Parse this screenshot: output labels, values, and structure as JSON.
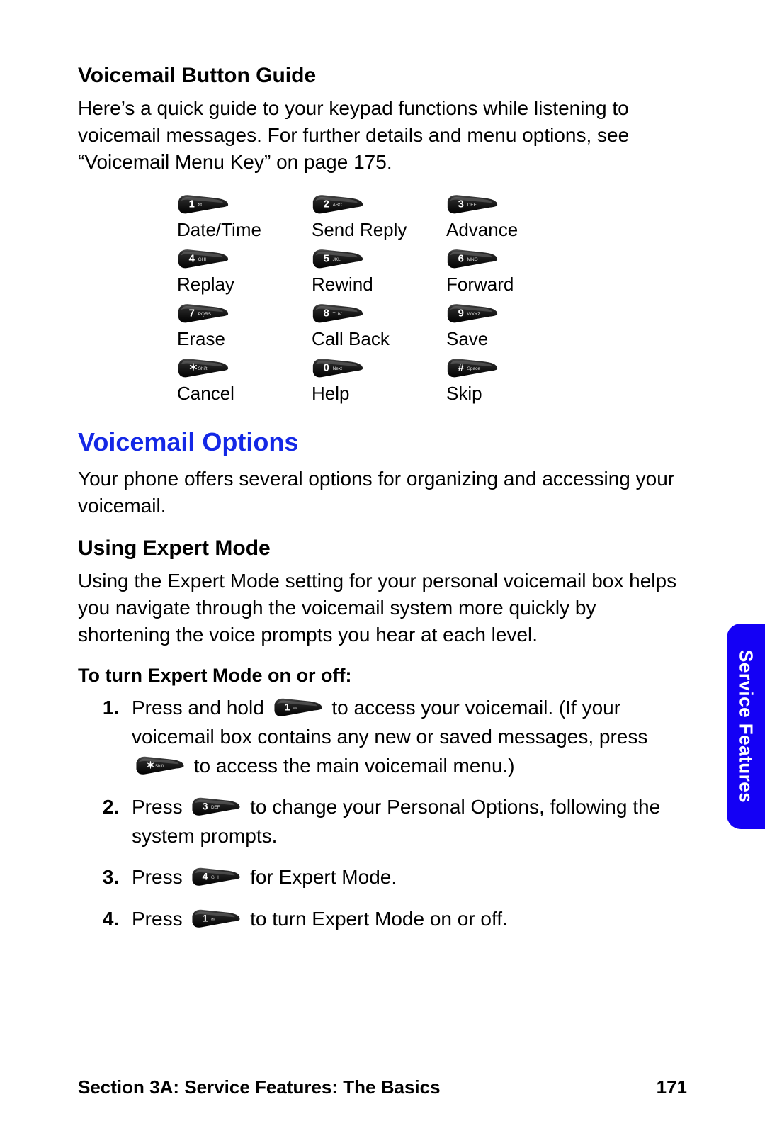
{
  "h1": "Voicemail Button Guide",
  "intro": "Here’s a quick guide to your keypad functions while listening to voicemail messages. For further details and menu options, see “Voicemail Menu Key” on page 175.",
  "keys": [
    {
      "num": "1",
      "sub": "✉",
      "label": "Date/Time"
    },
    {
      "num": "2",
      "sub": "ABC",
      "label": "Send Reply"
    },
    {
      "num": "3",
      "sub": "DEF",
      "label": "Advance"
    },
    {
      "num": "4",
      "sub": "GHI",
      "label": "Replay"
    },
    {
      "num": "5",
      "sub": "JKL",
      "label": "Rewind"
    },
    {
      "num": "6",
      "sub": "MNO",
      "label": "Forward"
    },
    {
      "num": "7",
      "sub": "PQRS",
      "label": "Erase"
    },
    {
      "num": "8",
      "sub": "TUV",
      "label": "Call Back"
    },
    {
      "num": "9",
      "sub": "WXYZ",
      "label": "Save"
    },
    {
      "num": "✶",
      "sub": "Shift",
      "label": "Cancel"
    },
    {
      "num": "0",
      "sub": "Next",
      "label": "Help"
    },
    {
      "num": "#",
      "sub": "Space",
      "label": "Skip"
    }
  ],
  "h2": "Voicemail Options",
  "options_intro": "Your phone offers several options for organizing and accessing your voicemail.",
  "h3": "Using Expert Mode",
  "expert_intro": "Using the Expert Mode setting for your personal voicemail box helps you navigate through the voicemail system more quickly by shortening the voice prompts you hear at each level.",
  "toggle_head": "To turn Expert Mode on or off:",
  "steps": {
    "s1a": "Press and hold ",
    "s1b": " to access your voicemail. (If your voicemail box contains any new or saved messages, press ",
    "s1c": " to access the main voicemail menu.)",
    "s2a": "Press ",
    "s2b": " to change your Personal Options, following the system prompts.",
    "s3a": "Press ",
    "s3b": " for Expert Mode.",
    "s4a": "Press ",
    "s4b": " to turn Expert Mode on or off."
  },
  "inline_keys": {
    "k1": {
      "num": "1",
      "sub": "✉"
    },
    "kstar": {
      "num": "✶",
      "sub": "Shift"
    },
    "k3": {
      "num": "3",
      "sub": "DEF"
    },
    "k4": {
      "num": "4",
      "sub": "GHI"
    },
    "k1b": {
      "num": "1",
      "sub": "✉"
    }
  },
  "side_tab": "Service Features",
  "footer_left": "Section 3A: Service Features: The Basics",
  "footer_right": "171"
}
